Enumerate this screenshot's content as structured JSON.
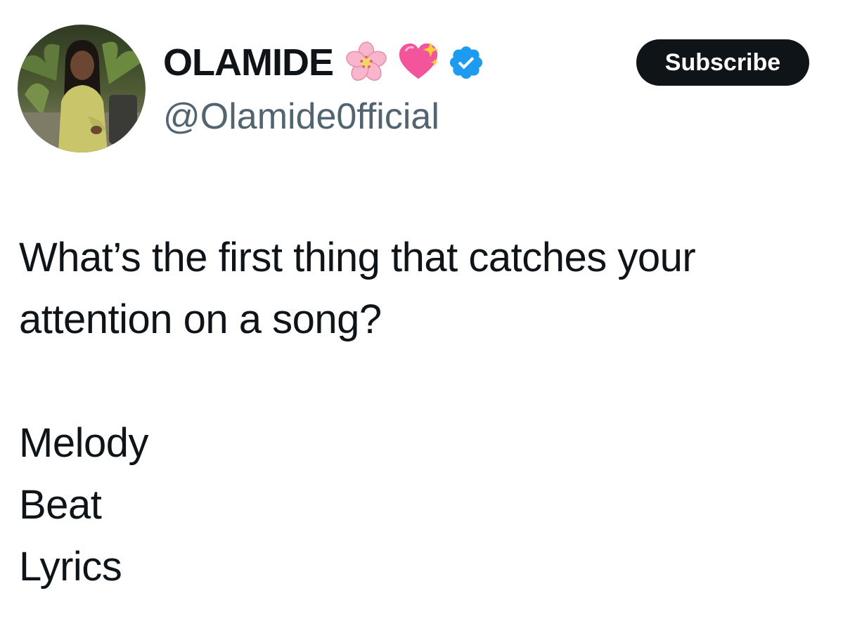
{
  "profile": {
    "display_name": "OLAMIDE",
    "handle": "@Olamide0fficial",
    "name_icons": [
      "cherry-blossom-emoji",
      "sparkling-heart-emoji",
      "verified-badge-icon"
    ],
    "verified_color": "#1d9bf0"
  },
  "actions": {
    "subscribe_label": "Subscribe"
  },
  "tweet": {
    "line1": "What’s the first thing that catches your",
    "line2": "attention on a song?",
    "options": [
      "Melody",
      "Beat",
      "Lyrics"
    ]
  },
  "colors": {
    "text": "#0f1419",
    "secondary_text": "#536471",
    "button_bg": "#0f1419"
  }
}
